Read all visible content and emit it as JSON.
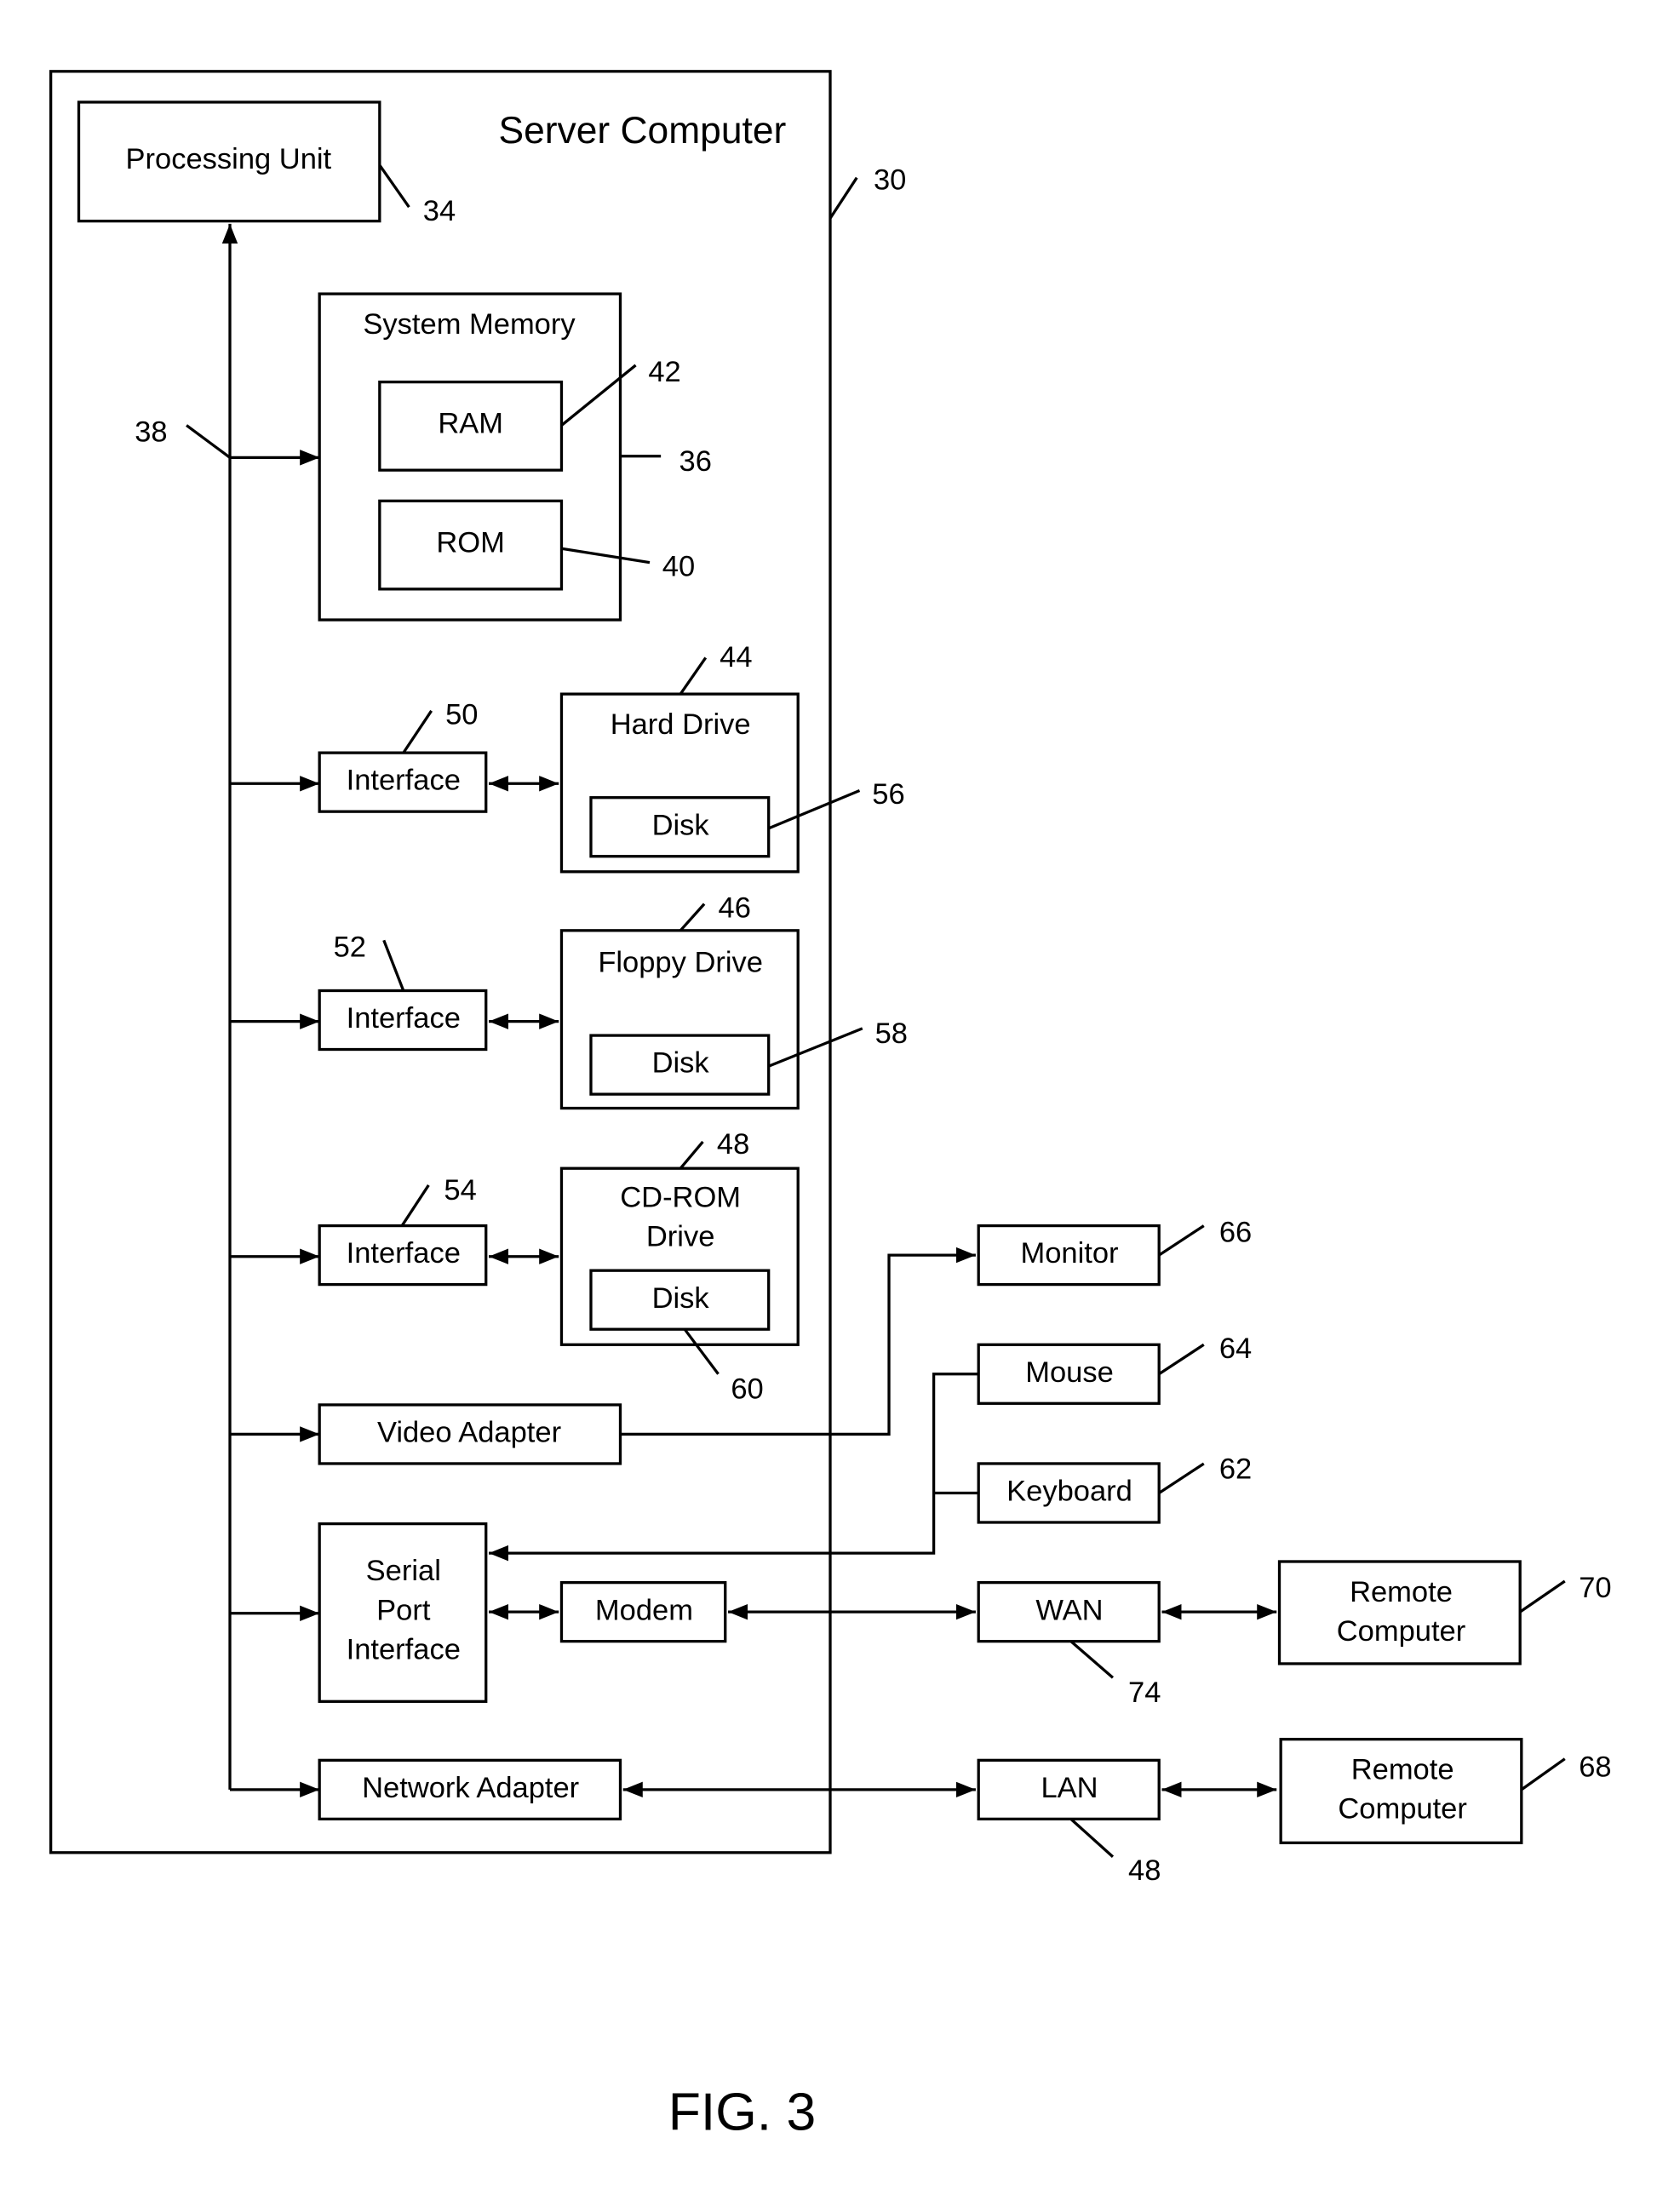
{
  "figure": {
    "caption": "FIG. 3",
    "container": {
      "title": "Server Computer",
      "ref": "30"
    },
    "blocks": {
      "processing_unit": {
        "label": "Processing Unit",
        "ref": "34"
      },
      "system_memory": {
        "label": "System Memory",
        "ref": "36"
      },
      "ram": {
        "label": "RAM",
        "ref": "42"
      },
      "rom": {
        "label": "ROM",
        "ref": "40"
      },
      "bus": {
        "ref": "38"
      },
      "hard_drive": {
        "label": "Hard Drive",
        "ref": "44",
        "disk_label": "Disk",
        "disk_ref": "56"
      },
      "floppy_drive": {
        "label": "Floppy Drive",
        "ref": "46",
        "disk_label": "Disk",
        "disk_ref": "58"
      },
      "cdrom_drive": {
        "label_line1": "CD-ROM",
        "label_line2": "Drive",
        "ref": "48",
        "disk_label": "Disk",
        "disk_ref": "60"
      },
      "interface_hd": {
        "label": "Interface",
        "ref": "50"
      },
      "interface_fd": {
        "label": "Interface",
        "ref": "52"
      },
      "interface_cd": {
        "label": "Interface",
        "ref": "54"
      },
      "video_adapter": {
        "label": "Video Adapter"
      },
      "serial_port": {
        "line1": "Serial",
        "line2": "Port",
        "line3": "Interface"
      },
      "modem": {
        "label": "Modem"
      },
      "network_adapter": {
        "label": "Network Adapter"
      },
      "monitor": {
        "label": "Monitor",
        "ref": "66"
      },
      "mouse": {
        "label": "Mouse",
        "ref": "64"
      },
      "keyboard": {
        "label": "Keyboard",
        "ref": "62"
      },
      "wan": {
        "label": "WAN",
        "ref": "74"
      },
      "lan": {
        "label": "LAN",
        "ref": "48"
      },
      "remote_computer_wan": {
        "line1": "Remote",
        "line2": "Computer",
        "ref": "70"
      },
      "remote_computer_lan": {
        "line1": "Remote",
        "line2": "Computer",
        "ref": "68"
      }
    }
  }
}
